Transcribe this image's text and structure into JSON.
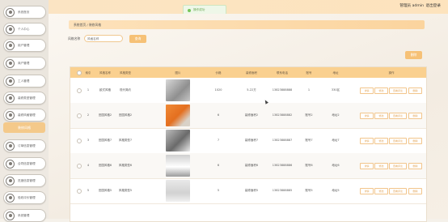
{
  "sidebar": {
    "items": [
      {
        "label": "系统首页",
        "active": false
      },
      {
        "label": "个人中心",
        "active": false
      },
      {
        "label": "用户管理",
        "active": false
      },
      {
        "label": "商户管理",
        "active": false
      },
      {
        "label": "工人管理",
        "active": false
      },
      {
        "label": "装修类型管理",
        "active": false
      },
      {
        "label": "装修风格管理",
        "active": false
      },
      {
        "label": "装修风格",
        "active": true
      },
      {
        "label": "订单信息管理",
        "active": false
      },
      {
        "label": "合同信息管理",
        "active": false
      },
      {
        "label": "进度信息管理",
        "active": false
      },
      {
        "label": "验收评价管理",
        "active": false
      },
      {
        "label": "系统管理",
        "active": false
      }
    ]
  },
  "topbar": {
    "user_text": "管理员 admin",
    "logout_label": "退出登录"
  },
  "toast": {
    "text": "操作成功"
  },
  "breadcrumb": {
    "text": "系统首页 / 装修风格"
  },
  "search": {
    "label": "风格名称",
    "placeholder": "风格名称",
    "query_label": "查询",
    "delete_label": "删除"
  },
  "table": {
    "headers": [
      "",
      "索引",
      "风格名称",
      "风格类型",
      "图片",
      "价格",
      "装修面积",
      "联系电话",
      "账号",
      "地址",
      "操作"
    ],
    "rows": [
      {
        "index": "1",
        "name": "欧式风格",
        "type": "现代简约",
        "thumb": "gray",
        "price": "1020",
        "area": "5-22方",
        "phone": "13823888888",
        "account": "1",
        "address": "330区"
      },
      {
        "index": "2",
        "name": "田园风格2",
        "type": "田园风格2",
        "thumb": "orange",
        "price": "6",
        "area": "装修面积2",
        "phone": "13823888882",
        "account": "账号2",
        "address": "地址2"
      },
      {
        "index": "3",
        "name": "田园风格7",
        "type": "风格类型7",
        "thumb": "dark",
        "price": "7",
        "area": "装修面积7",
        "phone": "13823888887",
        "account": "账号7",
        "address": "地址7"
      },
      {
        "index": "4",
        "name": "田园风格6",
        "type": "风格类型6",
        "thumb": "room",
        "price": "6",
        "area": "装修面积6",
        "phone": "13823888886",
        "account": "账号6",
        "address": "地址6"
      },
      {
        "index": "5",
        "name": "田园风格5",
        "type": "风格类型5",
        "thumb": "light",
        "price": "5",
        "area": "装修面积5",
        "phone": "13823888885",
        "account": "账号5",
        "address": "地址5"
      }
    ],
    "actions": [
      "详情",
      "修改",
      "查看评论",
      "删除"
    ]
  }
}
